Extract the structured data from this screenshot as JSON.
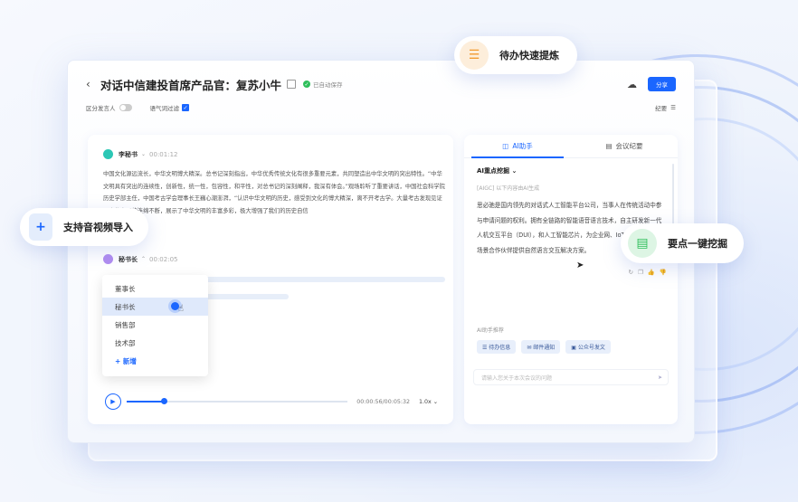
{
  "header": {
    "title": "对话中信建投首席产品官：复苏小牛",
    "saved_text": "已自动保存",
    "share_label": "分享"
  },
  "subbar": {
    "speaker_toggle_label": "区分发言人",
    "filter_label": "语气词过滤",
    "summary_label": "纪要"
  },
  "transcript": {
    "speaker1": {
      "name": "李秘书",
      "time": "00:01:12"
    },
    "paragraph": "中国文化源远流长，中华文明博大精深。总书记深刻指出，中华优秀传统文化有很多重要元素，共同塑造出中华文明的突出特性。“中华文明具有突出的连续性，创新性，统一性，包容性，和平性，对总书记的深刻阐释，我深有体会。”观场聆听了重要讲话，中国社会科学院历史学部主任，中国考古学会理事长王巍心潮澎湃，“认识中华文明的历史，感受到文化的博大精深，离不开考古学。大量考古发现见证了中华文明的连绵不断，展示了中华文明的丰富多彩，极大增强了我们的历史自信",
    "speaker2": {
      "name": "秘书长",
      "time": "00:02:05"
    }
  },
  "dropdown": {
    "items": [
      "董事长",
      "秘书长",
      "销售部",
      "技术部"
    ],
    "active_index": 1,
    "add_label": "+ 新增"
  },
  "player": {
    "time": "00:00:56/00:05:32",
    "speed": "1.0x",
    "progress": 0.17
  },
  "assistant": {
    "tabs": [
      "AI助手",
      "会议纪要"
    ],
    "heading": "AI重点挖掘",
    "source_note": "[AIGC] 以下内容由AI生成",
    "answer": "思必驰是国内领先的对话式人工智能平台公司，当事人在传统活动中参与申请问题的权利。拥有全链路的智能语音语言技术，自主研发新一代人机交互平台（DUI），和人工智能芯片，为企业网、IoT、以及众多行业场景合作伙伴提供自然语言交互解决方案。",
    "recommend_label": "AI助手推荐",
    "chips": [
      "待办信息",
      "邮件通知",
      "公众号发文"
    ],
    "input_placeholder": "请输入您关于本次会议的问题"
  },
  "callouts": {
    "todo": "待办快速提炼",
    "import": "支持音视频导入",
    "mine": "要点一键挖掘"
  },
  "colors": {
    "accent": "#1a66ff",
    "todo_icon": "#f29b30",
    "mine_icon": "#2fbf5b",
    "speaker1_avatar": "#2cc7b5",
    "speaker2_avatar": "#b18cf0"
  }
}
